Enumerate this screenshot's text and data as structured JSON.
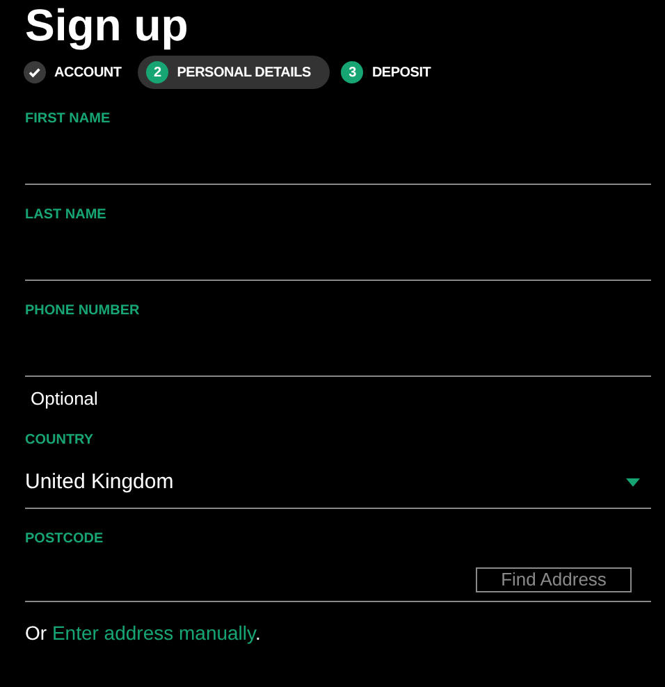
{
  "title": "Sign up",
  "steps": [
    {
      "label": "ACCOUNT",
      "completed": true,
      "selected": false
    },
    {
      "number": "2",
      "label": "PERSONAL DETAILS",
      "completed": false,
      "selected": true
    },
    {
      "number": "3",
      "label": "DEPOSIT",
      "completed": false,
      "selected": false
    }
  ],
  "fields": [
    {
      "kind": "text",
      "label": "FIRST NAME"
    },
    {
      "kind": "text",
      "label": "LAST NAME"
    },
    {
      "kind": "text",
      "label": "PHONE NUMBER",
      "hint": "Optional"
    },
    {
      "kind": "select",
      "label": "COUNTRY",
      "value": "United Kingdom"
    },
    {
      "kind": "postcode",
      "label": "POSTCODE",
      "button": "Find Address"
    }
  ],
  "footer": {
    "prefix": "Or",
    "link": "Enter address manually",
    "suffix": "."
  }
}
